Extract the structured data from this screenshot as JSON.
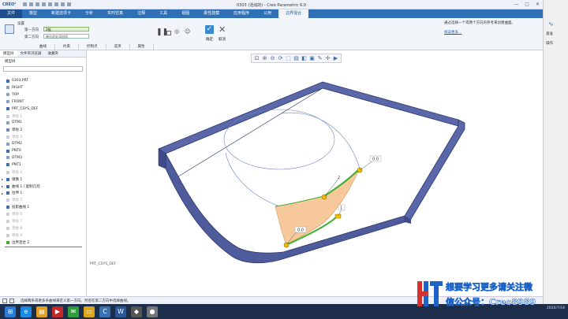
{
  "window": {
    "app_logo": "CREO°",
    "title": "0303 (活动的) - Creo Parametric 6.0",
    "controls": [
      "—",
      "▢",
      "✕"
    ]
  },
  "menu": {
    "tabs": [
      "文件",
      "模型",
      "新建选项卡",
      "分析",
      "实时仿真",
      "注释",
      "工具",
      "视图",
      "柔性建模",
      "应用程序",
      "公用",
      "边界混合"
    ]
  },
  "ribbon": {
    "settings_label": "设置",
    "first_direction_label": "第一方向",
    "first_direction_value": "2链",
    "second_direction_label": "第二方向",
    "second_direction_placeholder": "单击此处添加项",
    "subtabs": [
      "曲线",
      "约束",
      "控制点",
      "选项",
      "属性"
    ],
    "ok_label": "确定",
    "cancel_label": "取消",
    "help_text": "通过选择一个或两个方向的参考来创建曲面。",
    "help_link": "阅读更多..."
  },
  "right_strip": {
    "items": [
      "基准",
      "操作"
    ]
  },
  "panel": {
    "tabs": [
      "模型树",
      "文件夹浏览器",
      "收藏夹"
    ],
    "tree_header": "模型树",
    "items": [
      {
        "label": "0303.PRT",
        "dim": false,
        "icon": "part",
        "expand": ""
      },
      {
        "label": "RIGHT",
        "dim": false,
        "icon": "plane",
        "expand": ""
      },
      {
        "label": "TOP",
        "dim": false,
        "icon": "plane",
        "expand": ""
      },
      {
        "label": "FRONT",
        "dim": false,
        "icon": "plane",
        "expand": ""
      },
      {
        "label": "PRT_CSYS_DEF",
        "dim": false,
        "icon": "csys",
        "expand": ""
      },
      {
        "label": "草绘 1",
        "dim": true,
        "icon": "sketch",
        "expand": ""
      },
      {
        "label": "DTM1",
        "dim": false,
        "icon": "plane",
        "expand": ""
      },
      {
        "label": "草绘 2",
        "dim": false,
        "icon": "sketch",
        "expand": ""
      },
      {
        "label": "草绘 3",
        "dim": true,
        "icon": "sketch",
        "expand": ""
      },
      {
        "label": "DTM2",
        "dim": false,
        "icon": "plane",
        "expand": ""
      },
      {
        "label": "PNT0",
        "dim": false,
        "icon": "point",
        "expand": ""
      },
      {
        "label": "DTM3",
        "dim": false,
        "icon": "plane",
        "expand": ""
      },
      {
        "label": "PNT1",
        "dim": false,
        "icon": "point",
        "expand": ""
      },
      {
        "label": "草绘 4",
        "dim": true,
        "icon": "sketch",
        "expand": ""
      },
      {
        "label": "镜像 1",
        "dim": false,
        "icon": "mirror",
        "expand": "▸"
      },
      {
        "label": "曲线 1 / 复制几何",
        "dim": false,
        "icon": "curve",
        "expand": "▸"
      },
      {
        "label": "拉伸 1",
        "dim": false,
        "icon": "extrude",
        "expand": "▸"
      },
      {
        "label": "草绘 5",
        "dim": true,
        "icon": "sketch",
        "expand": ""
      },
      {
        "label": "投影曲线 1",
        "dim": false,
        "icon": "curve",
        "expand": ""
      },
      {
        "label": "草绘 6",
        "dim": true,
        "icon": "sketch",
        "expand": ""
      },
      {
        "label": "草绘 7",
        "dim": true,
        "icon": "sketch",
        "expand": ""
      },
      {
        "label": "草绘 8",
        "dim": true,
        "icon": "sketch",
        "expand": ""
      },
      {
        "label": "草绘 9",
        "dim": true,
        "icon": "sketch",
        "expand": ""
      },
      {
        "label": "边界混合 2",
        "dim": false,
        "icon": "boundary",
        "expand": ""
      }
    ]
  },
  "viewport": {
    "label": "PRT_CSYS_DEF",
    "dim_labels": [
      "0.0",
      "2",
      "1",
      "0.0"
    ],
    "colors": {
      "frame": "#5a67a8",
      "frame_side": "#3e4a8a",
      "surface": "#f6c89a",
      "curve": "#3fae2e",
      "guide": "#6b86c2",
      "handle": "#f2c200"
    }
  },
  "status": {
    "message": "选择两条或者多条曲线来定义第一方向。然后在第二方向中选择曲线。",
    "colors": {
      "accent": "#2f6fb6"
    }
  },
  "taskbar": {
    "icons": [
      "start",
      "ie",
      "explorer",
      "media",
      "wechat",
      "folder",
      "creo",
      "word",
      "app1",
      "app2"
    ],
    "clock": "2020/7/18"
  },
  "watermark": {
    "line1": "想要学习更多请关注微",
    "line2": "信公众号：Creo8989"
  }
}
